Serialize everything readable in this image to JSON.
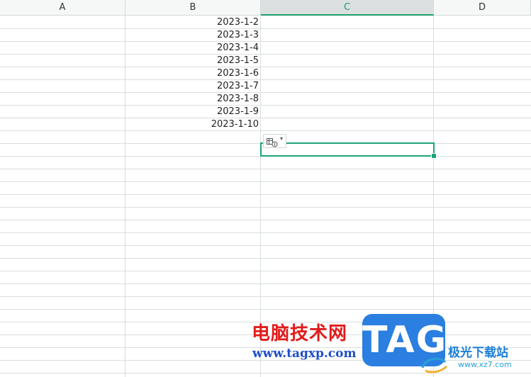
{
  "columns": {
    "a": "A",
    "b": "B",
    "c": "C",
    "d": "D"
  },
  "cells_b": [
    "2023-1-2",
    "2023-1-3",
    "2023-1-4",
    "2023-1-5",
    "2023-1-6",
    "2023-1-7",
    "2023-1-8",
    "2023-1-9",
    "2023-1-10"
  ],
  "colors": {
    "selection": "#1fa574",
    "selected_header_text": "#1b9e6f",
    "gridline": "#d8dedd"
  },
  "watermark": {
    "site_name_cn": "电脑技术网",
    "site_url": "www.tagxp.com",
    "logo_text": "TAG",
    "partner_name_cn": "极光下载站",
    "partner_url": "www.xz7.com"
  },
  "icons": {
    "paste_options": "paste-options-icon",
    "dropdown": "chevron-down-icon"
  }
}
